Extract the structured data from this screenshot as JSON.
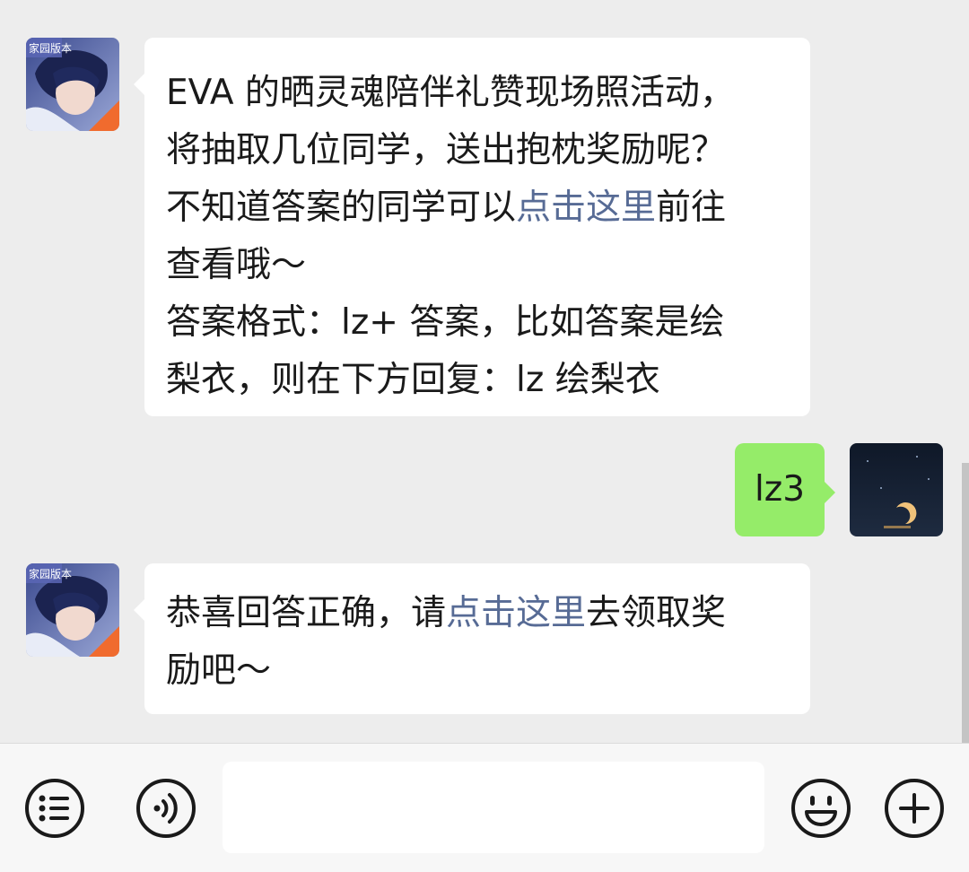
{
  "messages": [
    {
      "sender": "bot",
      "avatar": {
        "icon": "game-character-avatar",
        "badge_text": "家园版本"
      },
      "lines": [
        [
          {
            "text": "EVA 的晒灵魂陪伴礼赞现场照活动，",
            "link": false
          }
        ],
        [
          {
            "text": "将抽取几位同学，送出抱枕奖励呢？",
            "link": false
          }
        ],
        [
          {
            "text": "不知道答案的同学可以",
            "link": false
          },
          {
            "text": "点击这里",
            "link": true
          },
          {
            "text": "前往",
            "link": false
          }
        ],
        [
          {
            "text": "查看哦～",
            "link": false
          }
        ],
        [
          {
            "text": "答案格式：lz+ 答案，比如答案是绘",
            "link": false
          }
        ],
        [
          {
            "text": "梨衣，则在下方回复：lz 绘梨衣",
            "link": false
          }
        ]
      ]
    },
    {
      "sender": "user",
      "avatar": {
        "icon": "night-moon-avatar"
      },
      "text": "lz3"
    },
    {
      "sender": "bot",
      "avatar": {
        "icon": "game-character-avatar",
        "badge_text": "家园版本"
      },
      "lines": [
        [
          {
            "text": "恭喜回答正确，请",
            "link": false
          },
          {
            "text": "点击这里",
            "link": true
          },
          {
            "text": "去领取奖",
            "link": false
          }
        ],
        [
          {
            "text": "励吧～",
            "link": false
          }
        ]
      ]
    }
  ],
  "input": {
    "value": "",
    "placeholder": ""
  },
  "bottom_bar": {
    "left_icons": [
      "menu-icon",
      "voice-icon"
    ],
    "right_icons": [
      "emoji-icon",
      "plus-icon"
    ]
  },
  "colors": {
    "background": "#ededed",
    "incoming_bubble": "#ffffff",
    "outgoing_bubble": "#95ec69",
    "link": "#576b95"
  }
}
